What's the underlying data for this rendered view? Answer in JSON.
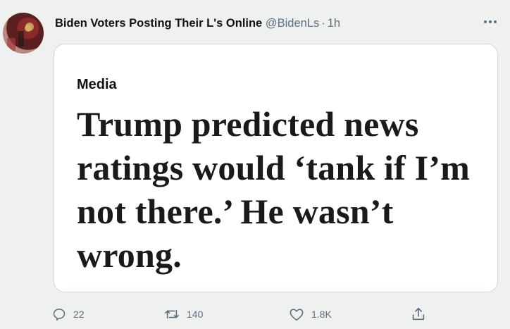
{
  "tweet": {
    "display_name": "Biden Voters Posting Their L's Online",
    "handle": "@BidenLs",
    "separator": "·",
    "time": "1h",
    "avatar_icon": "avatar-image",
    "more_icon": "more-horizontal-icon"
  },
  "card": {
    "kicker": "Media",
    "headline": "Trump predicted news ratings would ‘tank if I’m not there.’ He wasn’t wrong."
  },
  "actions": {
    "reply": {
      "icon": "reply-icon",
      "count": "22"
    },
    "retweet": {
      "icon": "retweet-icon",
      "count": "140"
    },
    "like": {
      "icon": "heart-icon",
      "count": "1.8K"
    },
    "share": {
      "icon": "share-icon"
    }
  },
  "colors": {
    "background": "#eff0f0",
    "card_background": "#ffffff",
    "card_border": "#cfd9de",
    "secondary_text": "#5b7083",
    "primary_text": "#0f1419"
  }
}
